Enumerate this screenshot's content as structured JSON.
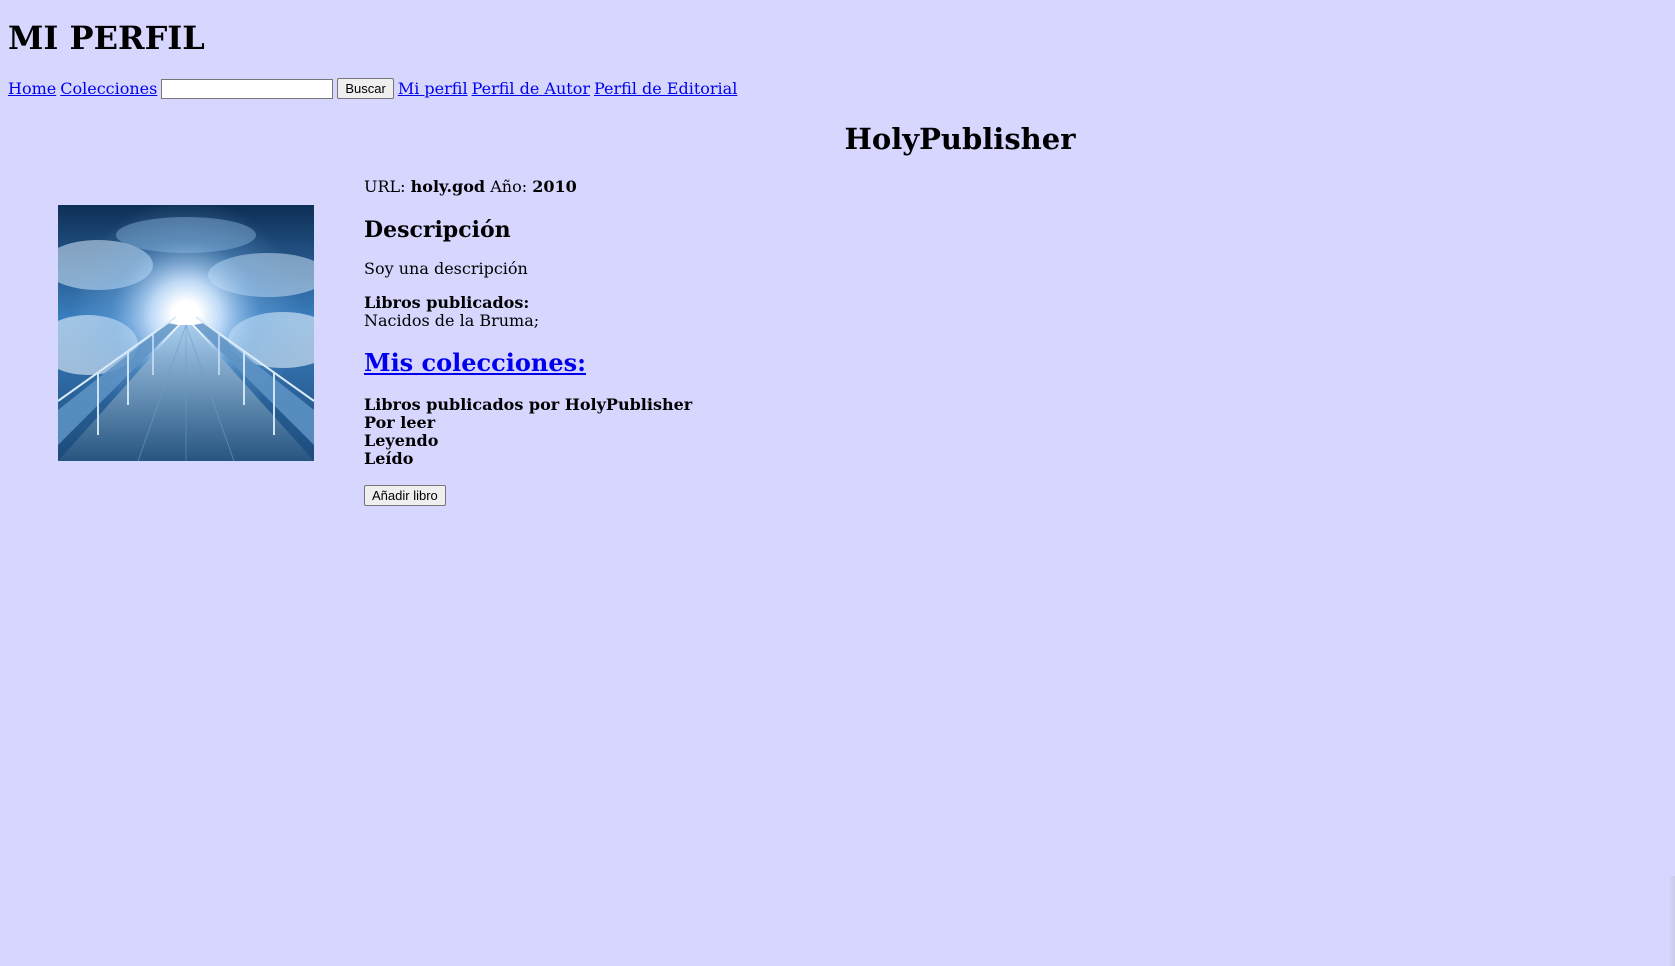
{
  "header": {
    "title": "MI PERFIL"
  },
  "nav": {
    "home": "Home",
    "collections": "Colecciones",
    "search_value": "",
    "search_button": "Buscar",
    "my_profile": "Mi perfil",
    "author_profile": "Perfil de Autor",
    "publisher_profile": "Perfil de Editorial"
  },
  "profile": {
    "name": "HolyPublisher",
    "image_icon": "sky-bridge-image",
    "url_label": "URL:",
    "url_value": "holy.god",
    "year_label": "Año:",
    "year_value": "2010",
    "description_title": "Descripción",
    "description_text": "Soy una descripción",
    "books_label": "Libros publicados:",
    "books_list": "Nacidos de la Bruma;",
    "collections_title": "Mis colecciones:",
    "collections": [
      "Libros publicados por HolyPublisher",
      "Por leer",
      "Leyendo",
      "Leído"
    ],
    "add_book_button": "Añadir libro"
  },
  "colors": {
    "background": "#d6d6fe",
    "link": "#0000ee"
  }
}
